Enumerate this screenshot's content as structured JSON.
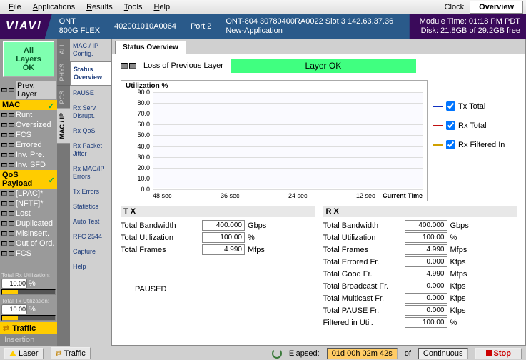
{
  "menu": {
    "file": "File",
    "apps": "Applications",
    "results": "Results",
    "tools": "Tools",
    "help": "Help",
    "clock": "Clock",
    "overview": "Overview"
  },
  "hdr": {
    "logo": "VIAVI",
    "ont_lbl": "ONT",
    "ont_model": "800G FLEX",
    "serial": "402001010A0064",
    "port": "Port 2",
    "dev": "ONT-804 30780400RA0022 Slot 3  142.63.37.36",
    "app": "New-Application",
    "time": "Module Time: 01:18 PM PDT",
    "disk": "Disk: 21.8GB of 29.2GB free"
  },
  "lcol": {
    "all": "All\nLayers\nOK",
    "prev": "Prev. Layer",
    "mac": "MAC",
    "mac_items": [
      "Runt",
      "Oversized",
      "FCS",
      "Errored",
      "Inv. Pre.",
      "Inv. SFD"
    ],
    "qos": "QoS Payload",
    "qos_items": [
      "[LPAC]*",
      "[NFTF]*",
      "Lost",
      "Duplicated",
      "Misinsert.",
      "Out of Ord.",
      "FCS"
    ],
    "rx_util_lbl": "Total Rx Utilization:",
    "rx_util": "10.00",
    "pct": "%",
    "tx_util_lbl": "Total Tx Utilization:",
    "tx_util": "10.00",
    "traffic": "Traffic",
    "insertion": "Insertion"
  },
  "vtabs": [
    "ALL",
    "PHYS",
    "PCS",
    "MAC / IP"
  ],
  "menu2": [
    "MAC / IP Config.",
    "Status Overview",
    "PAUSE",
    "Rx Serv. Disrupt.",
    "Rx QoS",
    "Rx Packet Jitter",
    "Rx MAC/IP Errors",
    "Tx Errors",
    "Statistics",
    "Auto Test",
    "RFC 2544",
    "Capture",
    "Help"
  ],
  "tab": "Status Overview",
  "status": {
    "loss": "Loss of Previous Layer",
    "ok": "Layer OK"
  },
  "chart_data": {
    "type": "line",
    "title": "Utilization %",
    "y_ticks": [
      90.0,
      80.0,
      70.0,
      60.0,
      50.0,
      40.0,
      30.0,
      20.0,
      10.0,
      0.0
    ],
    "x_ticks": [
      "48 sec",
      "36 sec",
      "24 sec",
      "12 sec"
    ],
    "current": "Current Time",
    "ylim": [
      0,
      100
    ],
    "series": [
      {
        "name": "Tx Total",
        "color": "#1030c0",
        "values": []
      },
      {
        "name": "Rx Total",
        "color": "#c01010",
        "values": []
      },
      {
        "name": "Rx Filtered In",
        "color": "#d0a000",
        "values": []
      }
    ]
  },
  "tx": {
    "hdr": "T X",
    "bw_lbl": "Total Bandwidth",
    "bw": "400.000",
    "bw_u": "Gbps",
    "util_lbl": "Total Utilization",
    "util": "100.00",
    "util_u": "%",
    "fr_lbl": "Total Frames",
    "fr": "4.990",
    "fr_u": "Mfps",
    "paused": "PAUSED"
  },
  "rx": {
    "hdr": "R X",
    "bw_lbl": "Total Bandwidth",
    "bw": "400.000",
    "bw_u": "Gbps",
    "util_lbl": "Total Utilization",
    "util": "100.00",
    "util_u": "%",
    "fr_lbl": "Total Frames",
    "fr": "4.990",
    "fr_u": "Mfps",
    "err_lbl": "Total Errored Fr.",
    "err": "0.000",
    "err_u": "Kfps",
    "good_lbl": "Total Good Fr.",
    "good": "4.990",
    "good_u": "Mfps",
    "bc_lbl": "Total Broadcast Fr.",
    "bc": "0.000",
    "bc_u": "Kfps",
    "mc_lbl": "Total Multicast Fr.",
    "mc": "0.000",
    "mc_u": "Kfps",
    "pause_lbl": "Total PAUSE Fr.",
    "pause": "0.000",
    "pause_u": "Kfps",
    "filt_lbl": "Filtered in Util.",
    "filt": "100.00",
    "filt_u": "%"
  },
  "footer": {
    "laser": "Laser",
    "traffic": "Traffic",
    "elapsed_lbl": "Elapsed:",
    "elapsed": "01d 00h 02m 42s",
    "of": "of",
    "mode": "Continuous",
    "stop": "Stop"
  }
}
